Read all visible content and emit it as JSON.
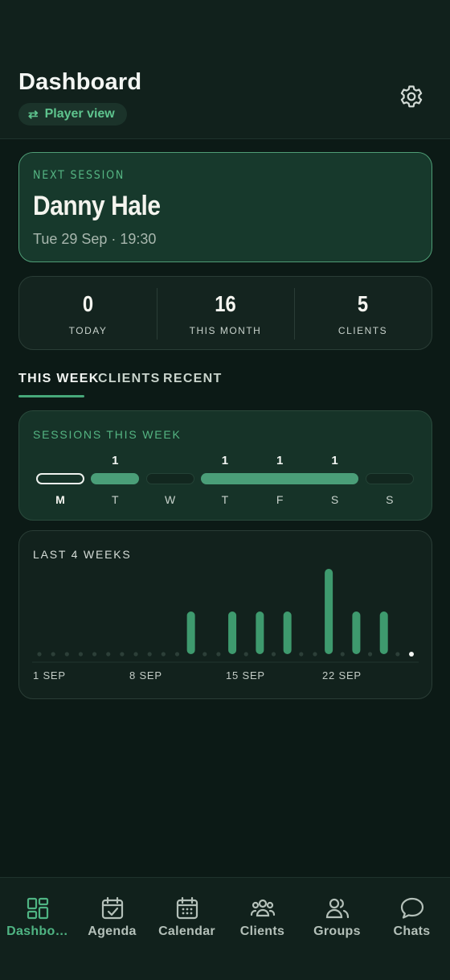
{
  "header": {
    "title": "Dashboard",
    "view_toggle": {
      "icon": "swap-arrows-icon",
      "label": "Player view"
    },
    "settings_icon": "gear-icon"
  },
  "next_session": {
    "label": "NEXT SESSION",
    "name": "Danny Hale",
    "when": "Tue 29 Sep · 19:30"
  },
  "stats": [
    {
      "value": "0",
      "label": "TODAY"
    },
    {
      "value": "16",
      "label": "THIS MONTH"
    },
    {
      "value": "5",
      "label": "CLIENTS"
    }
  ],
  "tabs": [
    {
      "label": "THIS WEEK",
      "active": true
    },
    {
      "label": "CLIENTS",
      "active": false
    },
    {
      "label": "RECENT",
      "active": false
    }
  ],
  "sessions_this_week": {
    "title": "SESSIONS THIS WEEK",
    "days": [
      {
        "letter": "M",
        "count": "",
        "state": "today"
      },
      {
        "letter": "T",
        "count": "1",
        "state": "filled"
      },
      {
        "letter": "W",
        "count": "",
        "state": "empty"
      },
      {
        "letter": "T",
        "count": "1",
        "state": "filled"
      },
      {
        "letter": "F",
        "count": "1",
        "state": "filled"
      },
      {
        "letter": "S",
        "count": "1",
        "state": "filled"
      },
      {
        "letter": "S",
        "count": "",
        "state": "empty"
      }
    ]
  },
  "last_4_weeks": {
    "title": "LAST 4 WEEKS",
    "chart_data": {
      "type": "bar",
      "x_labels": [
        "1 SEP",
        "8 SEP",
        "15 SEP",
        "22 SEP"
      ],
      "categories": [
        "1",
        "2",
        "3",
        "4",
        "5",
        "6",
        "7",
        "8",
        "9",
        "10",
        "11",
        "12",
        "13",
        "14",
        "15",
        "16",
        "17",
        "18",
        "19",
        "20",
        "21",
        "22",
        "23",
        "24",
        "25",
        "26",
        "27",
        "28"
      ],
      "values": [
        0,
        0,
        0,
        0,
        0,
        0,
        0,
        0,
        0,
        0,
        0,
        1,
        0,
        0,
        1,
        0,
        1,
        0,
        1,
        0,
        0,
        2,
        0,
        1,
        0,
        1,
        0,
        0
      ],
      "today_index": 27,
      "accent": "#3e9a6e"
    }
  },
  "bottom_nav": [
    {
      "label": "Dashbo…",
      "icon": "dashboard-icon",
      "active": true
    },
    {
      "label": "Agenda",
      "icon": "agenda-icon",
      "active": false
    },
    {
      "label": "Calendar",
      "icon": "calendar-icon",
      "active": false
    },
    {
      "label": "Clients",
      "icon": "clients-icon",
      "active": false
    },
    {
      "label": "Groups",
      "icon": "groups-icon",
      "active": false
    },
    {
      "label": "Chats",
      "icon": "chats-icon",
      "active": false
    }
  ]
}
